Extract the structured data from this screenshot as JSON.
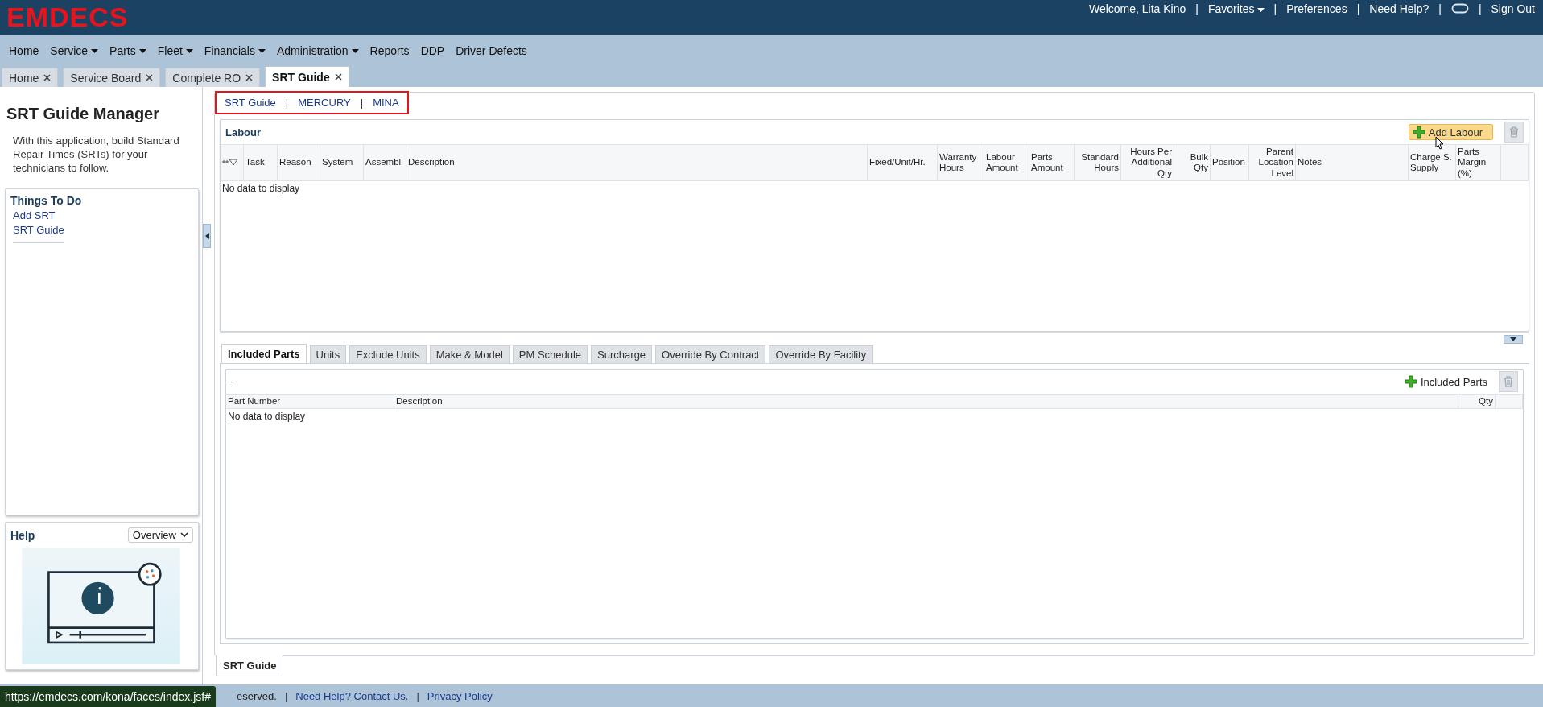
{
  "header": {
    "logo": "EMDECS",
    "separator": "|",
    "links": [
      {
        "kind": "text",
        "label": "Welcome, Lita Kino"
      },
      {
        "kind": "menu",
        "label": "Favorites"
      },
      {
        "kind": "link",
        "label": "Preferences"
      },
      {
        "kind": "link",
        "label": "Need Help?"
      },
      {
        "kind": "icon"
      },
      {
        "kind": "link",
        "label": "Sign Out"
      }
    ]
  },
  "menu": [
    {
      "label": "Home",
      "dropdown": false
    },
    {
      "label": "Service",
      "dropdown": true
    },
    {
      "label": "Parts",
      "dropdown": true
    },
    {
      "label": "Fleet",
      "dropdown": true
    },
    {
      "label": "Financials",
      "dropdown": true
    },
    {
      "label": "Administration",
      "dropdown": true
    },
    {
      "label": "Reports",
      "dropdown": false
    },
    {
      "label": "DDP",
      "dropdown": false
    },
    {
      "label": "Driver Defects",
      "dropdown": false
    }
  ],
  "tabs": [
    {
      "label": "Home",
      "selected": false
    },
    {
      "label": "Service Board",
      "selected": false
    },
    {
      "label": "Complete RO",
      "selected": false
    },
    {
      "label": "SRT Guide",
      "selected": true
    }
  ],
  "sidebar": {
    "title": "SRT Guide Manager",
    "description": "With this application, build Standard Repair Times (SRTs) for your technicians to follow.",
    "things_to_do": {
      "title": "Things To Do",
      "links": [
        "Add SRT",
        "SRT Guide"
      ]
    },
    "help": {
      "title": "Help",
      "select": "Overview"
    }
  },
  "breadcrumb": {
    "separator": "|",
    "items": [
      "SRT Guide",
      "MERCURY",
      "MINA"
    ]
  },
  "labour": {
    "title": "Labour",
    "add_button": "Add Labour",
    "empty_message": "No data to display",
    "columns": [
      {
        "kind": "sort"
      },
      {
        "kind": "text",
        "label": "Task"
      },
      {
        "kind": "text",
        "label": "Reason"
      },
      {
        "kind": "text",
        "label": "System"
      },
      {
        "kind": "text",
        "label": "Assembl"
      },
      {
        "kind": "text",
        "label": "Description"
      },
      {
        "kind": "text",
        "label": "Fixed/Unit/Hr."
      },
      {
        "kind": "text",
        "label": "Warranty Hours"
      },
      {
        "kind": "text",
        "label": "Labour Amount"
      },
      {
        "kind": "text",
        "label": "Parts Amount"
      },
      {
        "kind": "number",
        "label": "Standard Hours"
      },
      {
        "kind": "number",
        "label": "Hours Per Additional Qty"
      },
      {
        "kind": "number",
        "label": "Bulk Qty"
      },
      {
        "kind": "text",
        "label": "Position"
      },
      {
        "kind": "number",
        "label": "Parent Location Level"
      },
      {
        "kind": "text",
        "label": "Notes"
      },
      {
        "kind": "text",
        "label": "Charge S. Supply"
      },
      {
        "kind": "text",
        "label": "Parts Margin (%)"
      }
    ]
  },
  "subtabs": [
    {
      "label": "Included Parts",
      "selected": true
    },
    {
      "label": "Units",
      "selected": false
    },
    {
      "label": "Exclude Units",
      "selected": false
    },
    {
      "label": "Make & Model",
      "selected": false
    },
    {
      "label": "PM Schedule",
      "selected": false
    },
    {
      "label": "Surcharge",
      "selected": false
    },
    {
      "label": "Override By Contract",
      "selected": false
    },
    {
      "label": "Override By Facility",
      "selected": false
    }
  ],
  "included_parts": {
    "title": "-",
    "add_button": "Included Parts",
    "empty_message": "No data to display",
    "columns": [
      {
        "kind": "text",
        "label": "Part Number"
      },
      {
        "kind": "text",
        "label": "Description"
      },
      {
        "kind": "number",
        "label": "Qty"
      }
    ]
  },
  "bottom_tab": "SRT Guide",
  "footer": {
    "separator": "|",
    "items": [
      {
        "kind": "text",
        "label": "eserved."
      },
      {
        "kind": "link",
        "label": "Need Help? Contact Us."
      },
      {
        "kind": "link",
        "label": "Privacy Policy"
      }
    ]
  },
  "status_url": "https://emdecs.com/kona/faces/index.jsf#"
}
